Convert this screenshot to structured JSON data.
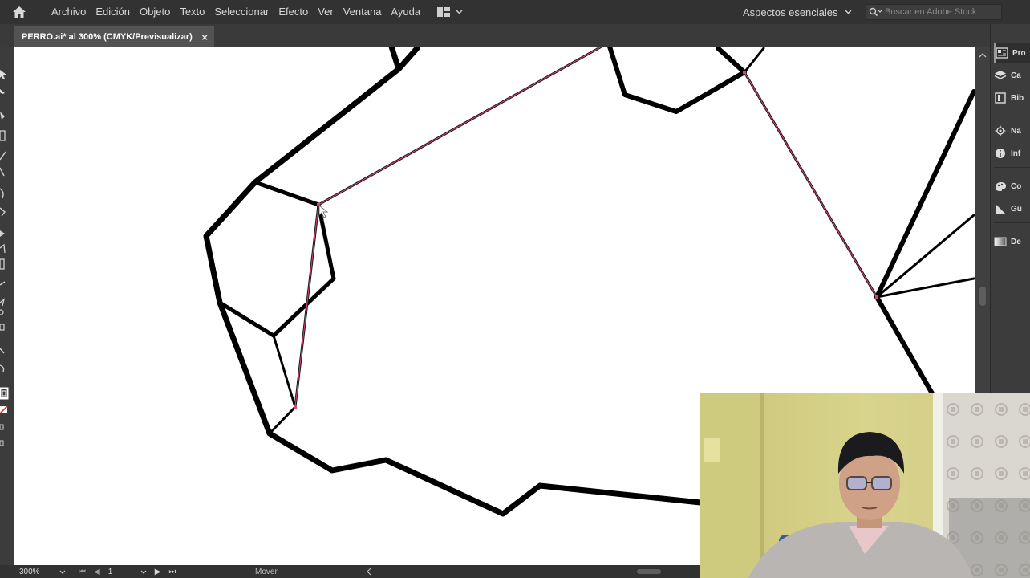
{
  "menu": [
    "Archivo",
    "Edición",
    "Objeto",
    "Texto",
    "Seleccionar",
    "Efecto",
    "Ver",
    "Ventana",
    "Ayuda"
  ],
  "workspace": {
    "label": "Aspectos esenciales"
  },
  "search": {
    "placeholder": "Buscar en Adobe Stock"
  },
  "document_tab": {
    "title": "PERRO.ai* al 300% (CMYK/Previsualizar)",
    "close": "×"
  },
  "panels": [
    {
      "label": "Pro",
      "icon": "properties-icon"
    },
    {
      "label": "Ca",
      "icon": "layers-icon"
    },
    {
      "label": "Bib",
      "icon": "libraries-icon"
    },
    {
      "label": "Na",
      "icon": "navigator-icon"
    },
    {
      "label": "Inf",
      "icon": "info-icon"
    },
    {
      "label": "Co",
      "icon": "color-icon"
    },
    {
      "label": "Gu",
      "icon": "color-guide-icon"
    },
    {
      "label": "De",
      "icon": "gradient-icon"
    }
  ],
  "status": {
    "zoom": "300%",
    "artboard": "1",
    "tool": "Mover"
  },
  "colors": {
    "menubar": "#323232",
    "panel": "#3c3c3c",
    "canvas": "#ffffff",
    "stroke": "#000000",
    "selection": "#e0407a"
  }
}
